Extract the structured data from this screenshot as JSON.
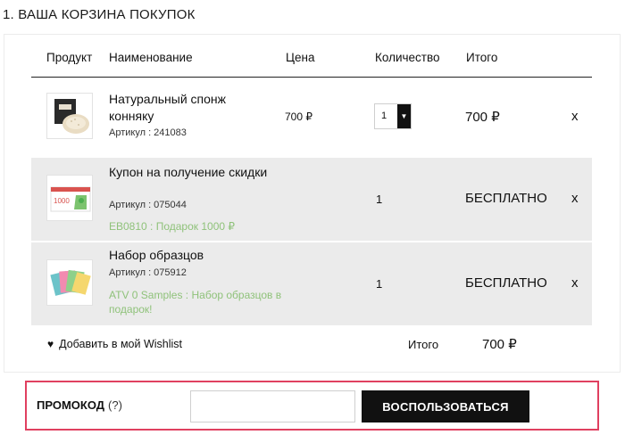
{
  "section": {
    "title": "1. ВАША КОРЗИНА ПОКУПОК"
  },
  "cart": {
    "headers": {
      "product": "Продукт",
      "name": "Наименование",
      "price": "Цена",
      "quantity": "Количество",
      "total": "Итого"
    },
    "items": [
      {
        "name": "Натуральный спонж конняку",
        "sku": "Артикул : 241083",
        "price": "700 ₽",
        "quantity": "1",
        "quantity_arrow": "▼",
        "total": "700 ₽",
        "remove": "x"
      },
      {
        "name": "Купон на получение скидки",
        "sku": "Артикул : 075044",
        "promo": "EB0810 : Подарок 1000 ₽",
        "quantity": "1",
        "total": "БЕСПЛАТНО",
        "remove": "x",
        "thumb_text": "1000"
      },
      {
        "name": "Набор образцов",
        "sku": "Артикул : 075912",
        "promo": "ATV 0 Samples : Набор образцов в подарок!",
        "quantity": "1",
        "total": "БЕСПЛАТНО",
        "remove": "x"
      }
    ],
    "footer": {
      "wishlist_icon": "♥",
      "wishlist_label": "Добавить в мой Wishlist",
      "total_label": "Итого",
      "total_value": "700 ₽"
    }
  },
  "promo": {
    "label": "ПРОМОКОД",
    "help": "(?)",
    "input_value": "",
    "button_label": "ВОСПОЛЬЗОВАТЬСЯ"
  },
  "colors": {
    "accent_border": "#e04060",
    "promo_note": "#8fc27a",
    "row_alt_bg": "#ebebeb",
    "button_bg": "#111111"
  }
}
